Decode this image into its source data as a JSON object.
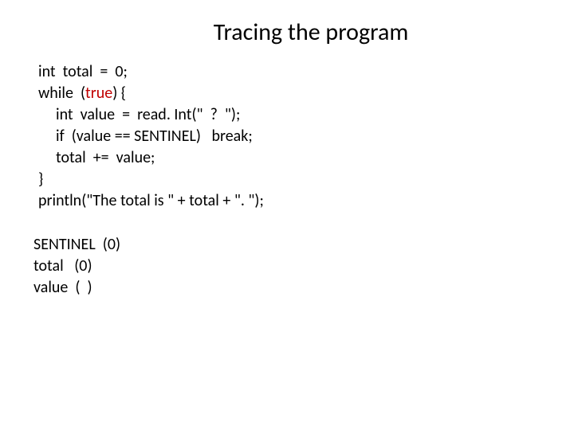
{
  "title": "Tracing the program",
  "code": {
    "l1": "int  total  =  0;",
    "l2a": "while  (",
    "l2_true": "true",
    "l2b": ") {",
    "l3": "int  value  =  read. Int(\"  ?  \");",
    "l4": "if  (value == SENTINEL)   break;",
    "l5": "total  +=  value;",
    "l6": "}",
    "l7": "println(\"The total is \" + total + \". \");"
  },
  "trace": {
    "l1": "SENTINEL  (0)",
    "l2": "total   (0)",
    "l3": "value  (  )"
  }
}
